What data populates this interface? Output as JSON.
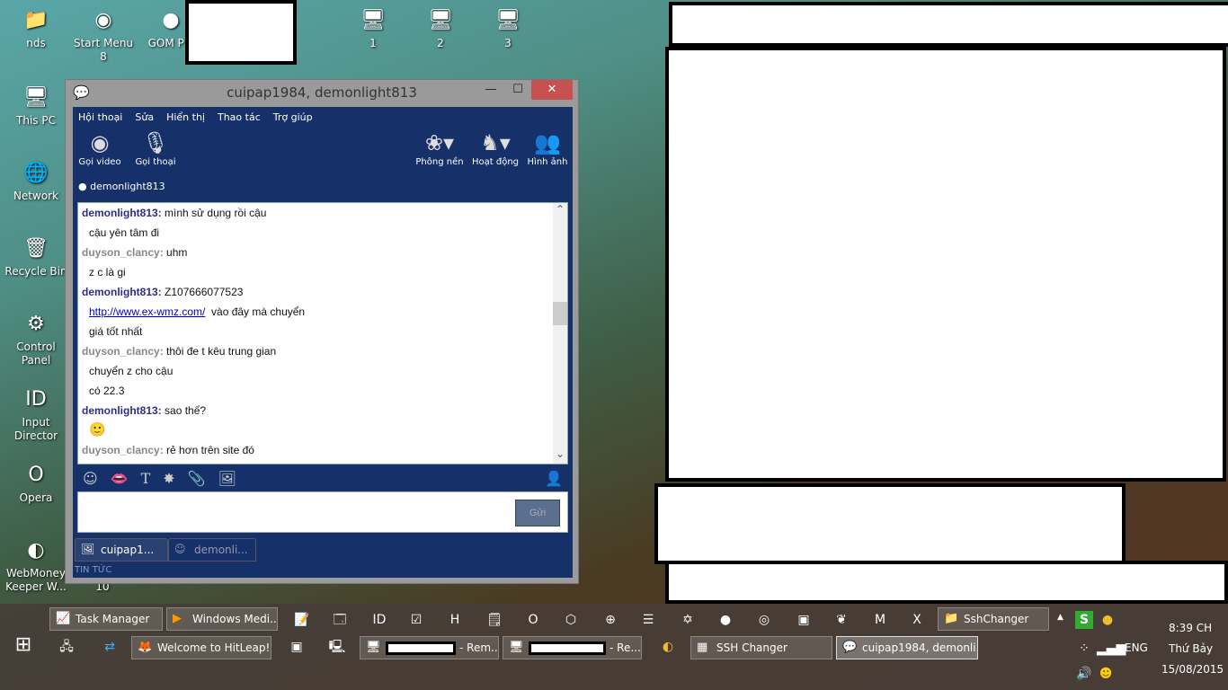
{
  "desktop": {
    "icons": [
      {
        "label": "nds",
        "glyph": "📁"
      },
      {
        "label": "Start Menu 8",
        "glyph": "◉"
      },
      {
        "label": "GOM Pla",
        "glyph": "●"
      },
      {
        "label": "1",
        "glyph": "🖥"
      },
      {
        "label": "2",
        "glyph": "🖥"
      },
      {
        "label": "3",
        "glyph": "🖥"
      },
      {
        "label": "This PC",
        "glyph": "🖥"
      },
      {
        "label": "Network",
        "glyph": "🌐"
      },
      {
        "label": "Recycle Bin",
        "glyph": "🗑"
      },
      {
        "label": "Control Panel",
        "glyph": "⚙"
      },
      {
        "label": "Input Director",
        "glyph": "ID"
      },
      {
        "label": "Opera",
        "glyph": "O"
      },
      {
        "label": "WebMoney Keeper W...",
        "glyph": "◐"
      }
    ],
    "partial_label": "10"
  },
  "window": {
    "title": "cuipap1984, demonlight813",
    "minimize": "—",
    "maximize": "☐",
    "close": "✕",
    "menu": [
      "Hội thoại",
      "Sửa",
      "Hiển thị",
      "Thao tác",
      "Trợ giúp"
    ],
    "tools_left": [
      {
        "label": "Gọi video",
        "icon": "webcam-icon"
      },
      {
        "label": "Gọi thoại",
        "icon": "microphone-icon"
      }
    ],
    "tools_right": [
      {
        "label": "Phông nền",
        "icon": "leaf-icon"
      },
      {
        "label": "Hoạt động",
        "icon": "chess-knight-icon"
      },
      {
        "label": "Hình ảnh",
        "icon": "photo-icon"
      }
    ],
    "contact": "demonlight813",
    "messages": [
      {
        "sender": "demonlight813:",
        "type": "d",
        "text": "mình sử dụng rồi cậu"
      },
      {
        "text": "cậu yên tâm đi"
      },
      {
        "sender": "duyson_clancy:",
        "type": "u",
        "text": "uhm"
      },
      {
        "text": "z c là gi"
      },
      {
        "sender": "demonlight813:",
        "type": "d",
        "text": "Z107666077523"
      },
      {
        "link": "http://www.ex-wmz.com/",
        "text": "  vào đây mà chuyển"
      },
      {
        "text": "giá tốt nhất"
      },
      {
        "sender": "duyson_clancy:",
        "type": "u",
        "text": "thôi đe t kêu trung gian"
      },
      {
        "text": "chuyển z cho cậu"
      },
      {
        "text": "có 22.3"
      },
      {
        "sender": "demonlight813:",
        "type": "d",
        "text": "sao thế?"
      },
      {
        "text": "🙂",
        "emoticon": true
      },
      {
        "sender": "duyson_clancy:",
        "type": "u",
        "text": "rẻ hơn trên site đó"
      }
    ],
    "input_value": "",
    "send": "Gửi",
    "tabs": [
      "cuipap1...",
      "demonli..."
    ],
    "news": "TIN TỨC"
  },
  "taskbar": {
    "row1": [
      {
        "label": "Task Manager"
      },
      {
        "label": "Windows Medi..."
      },
      {
        "label": "SshChanger"
      }
    ],
    "row2": [
      {
        "label": "Welcome to HitLeap!..."
      },
      {
        "label": "- Rem..."
      },
      {
        "label": "- Re..."
      },
      {
        "label": "SSH Changer"
      },
      {
        "label": "cuipap1984, demonli..."
      }
    ],
    "tray": {
      "time": "8:39 CH",
      "day": "Thứ Bảy",
      "date": "15/08/2015",
      "lang": "ENG"
    }
  }
}
